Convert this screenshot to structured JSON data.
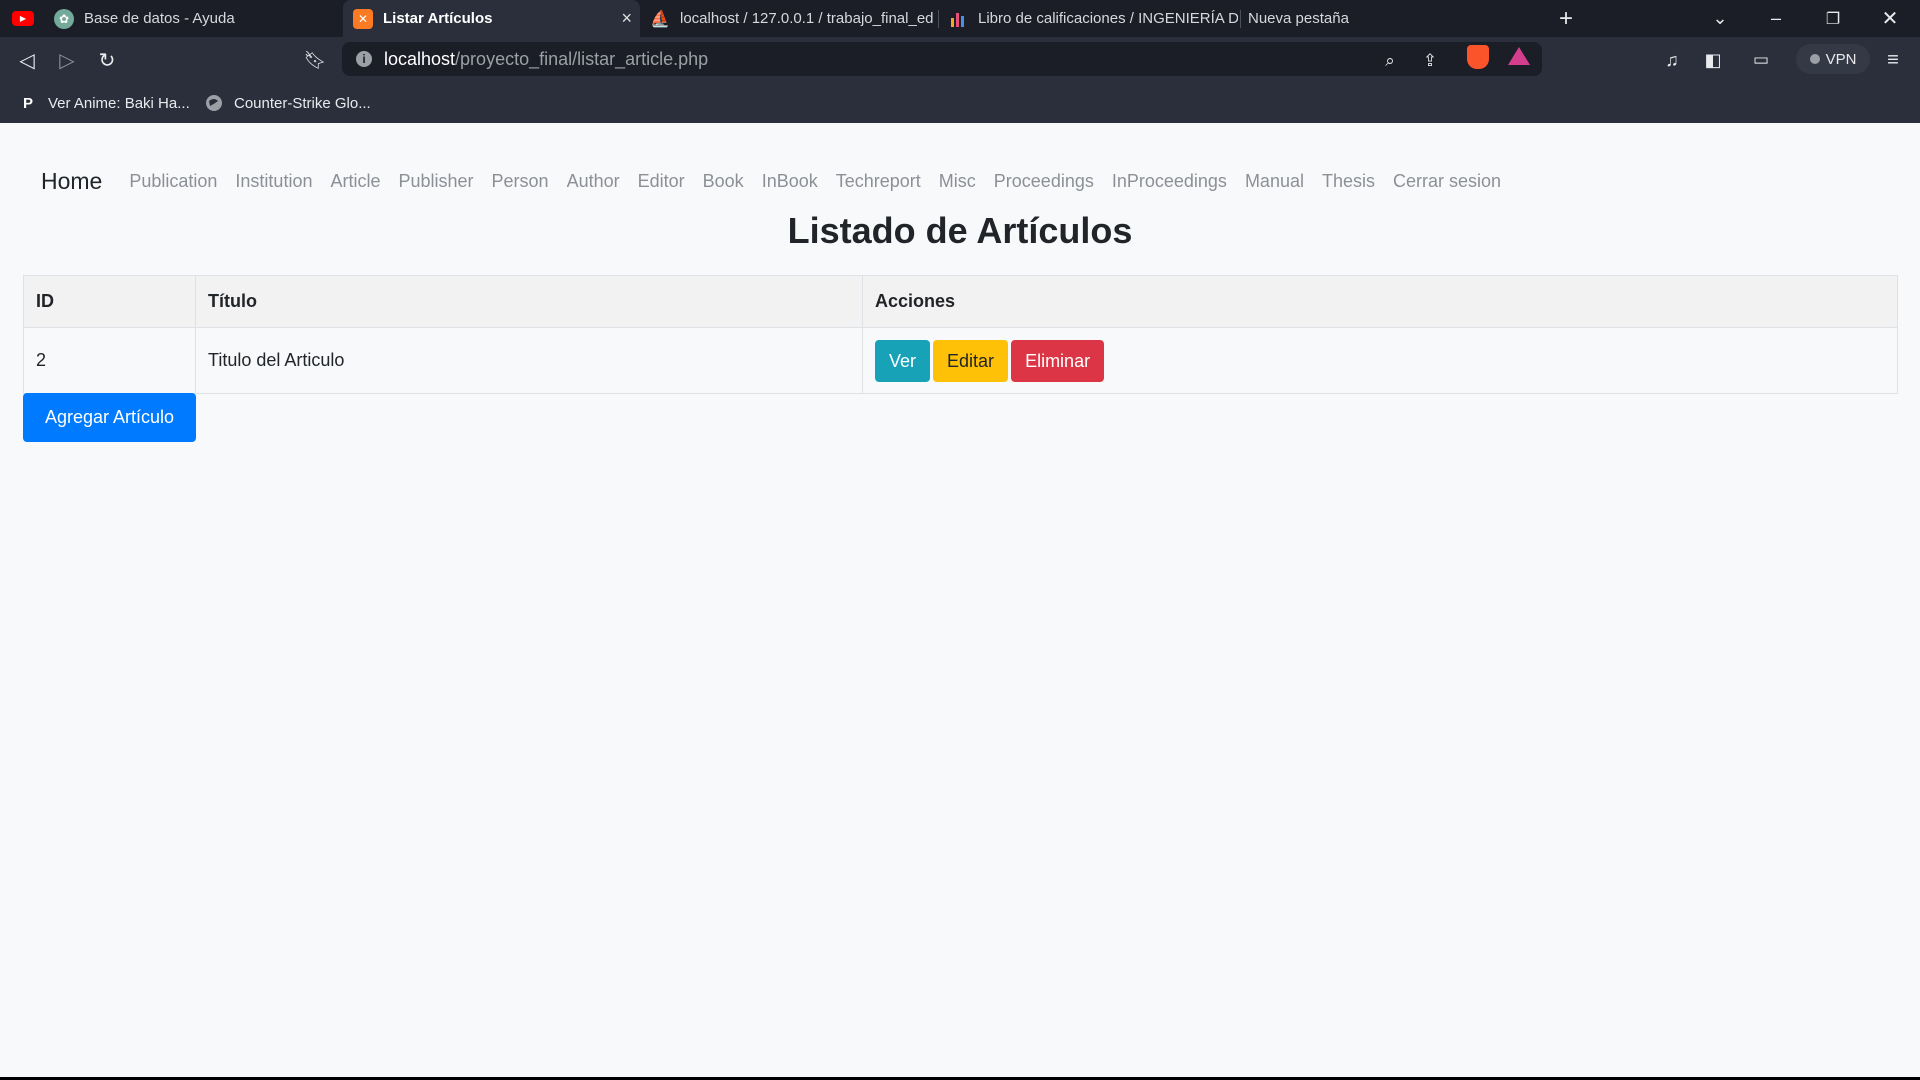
{
  "browser": {
    "tabs": [
      {
        "title": "Base de datos - Ayuda",
        "icon": "youtube-icon",
        "active": false
      },
      {
        "title": "Listar Artículos",
        "icon": "xampp-icon",
        "active": true
      },
      {
        "title": "localhost / 127.0.0.1 / trabajo_final_ed",
        "icon": "phpmyadmin-icon",
        "active": false
      },
      {
        "title": "Libro de calificaciones / INGENIERÍA D",
        "icon": "bar-chart-icon",
        "active": false
      },
      {
        "title": "Nueva pestaña",
        "icon": "",
        "active": false
      }
    ],
    "url": {
      "host": "localhost",
      "path": "/proyecto_final/listar_article.php"
    },
    "vpn_label": "VPN",
    "bookmarks": [
      {
        "label": "Ver Anime: Baki Ha...",
        "icon": "p-icon"
      },
      {
        "label": "Counter-Strike Glo...",
        "icon": "globe-icon"
      }
    ],
    "colors": {
      "tabstrip": "#1b1e26",
      "toolbar": "#2a2f3b"
    }
  },
  "navbar": {
    "brand": "Home",
    "links": [
      "Publication",
      "Institution",
      "Article",
      "Publisher",
      "Person",
      "Author",
      "Editor",
      "Book",
      "InBook",
      "Techreport",
      "Misc",
      "Proceedings",
      "InProceedings",
      "Manual",
      "Thesis",
      "Cerrar sesion"
    ]
  },
  "main": {
    "title": "Listado de Artículos",
    "table": {
      "headers": [
        "ID",
        "Título",
        "Acciones"
      ],
      "rows": [
        {
          "id": "2",
          "title": "Titulo del Articulo",
          "actions": [
            "Ver",
            "Editar",
            "Eliminar"
          ]
        }
      ]
    },
    "add_button": "Agregar Artículo",
    "colors": {
      "ver": "#17a2b8",
      "editar": "#ffc107",
      "eliminar": "#dc3545",
      "agregar": "#007bff"
    }
  }
}
